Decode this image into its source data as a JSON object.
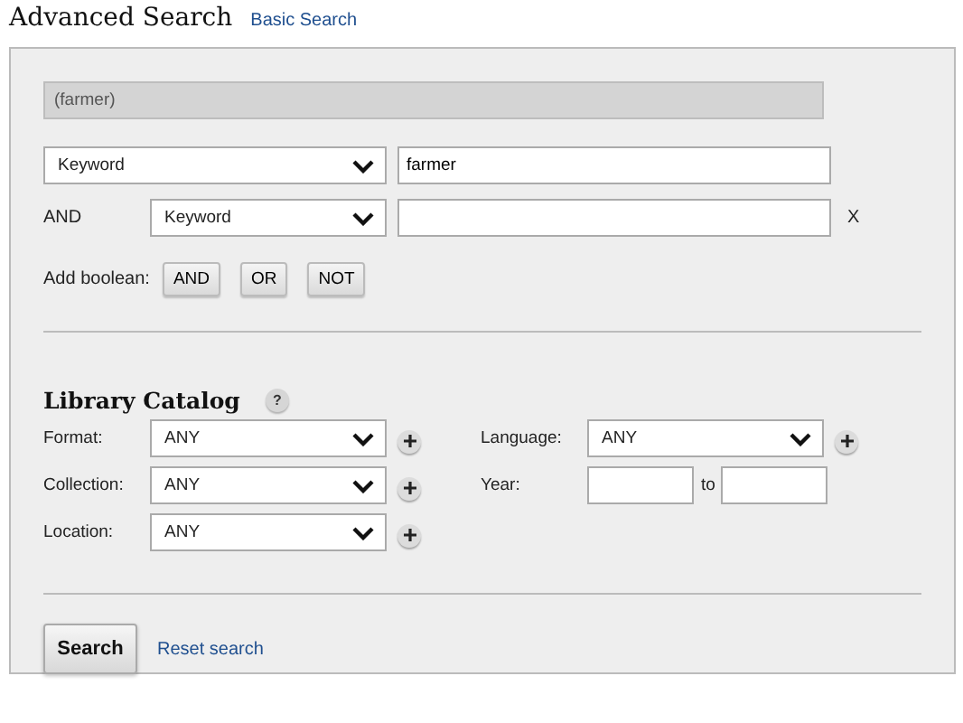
{
  "header": {
    "title": "Advanced Search",
    "link": "Basic Search"
  },
  "query_preview": {
    "value": "(farmer)"
  },
  "search_rows": [
    {
      "field": "Keyword",
      "value": "farmer"
    },
    {
      "operator": "AND",
      "field": "Keyword",
      "remove": "X"
    }
  ],
  "add_boolean": {
    "label": "Add boolean:",
    "buttons": [
      "AND",
      "OR",
      "NOT"
    ]
  },
  "catalog": {
    "title": "Library Catalog",
    "help": "?",
    "column_1": [
      {
        "kind": "select",
        "label": "Format:",
        "value": "ANY"
      },
      {
        "kind": "select",
        "label": "Collection:",
        "value": "ANY"
      },
      {
        "kind": "select",
        "label": "Location:",
        "value": "ANY"
      }
    ],
    "column_2": [
      {
        "kind": "select",
        "label": "Language:",
        "value": "ANY"
      },
      {
        "kind": "range",
        "label": "Year:",
        "separator": "to"
      }
    ]
  },
  "actions": {
    "search": "Search",
    "reset": "Reset search"
  }
}
